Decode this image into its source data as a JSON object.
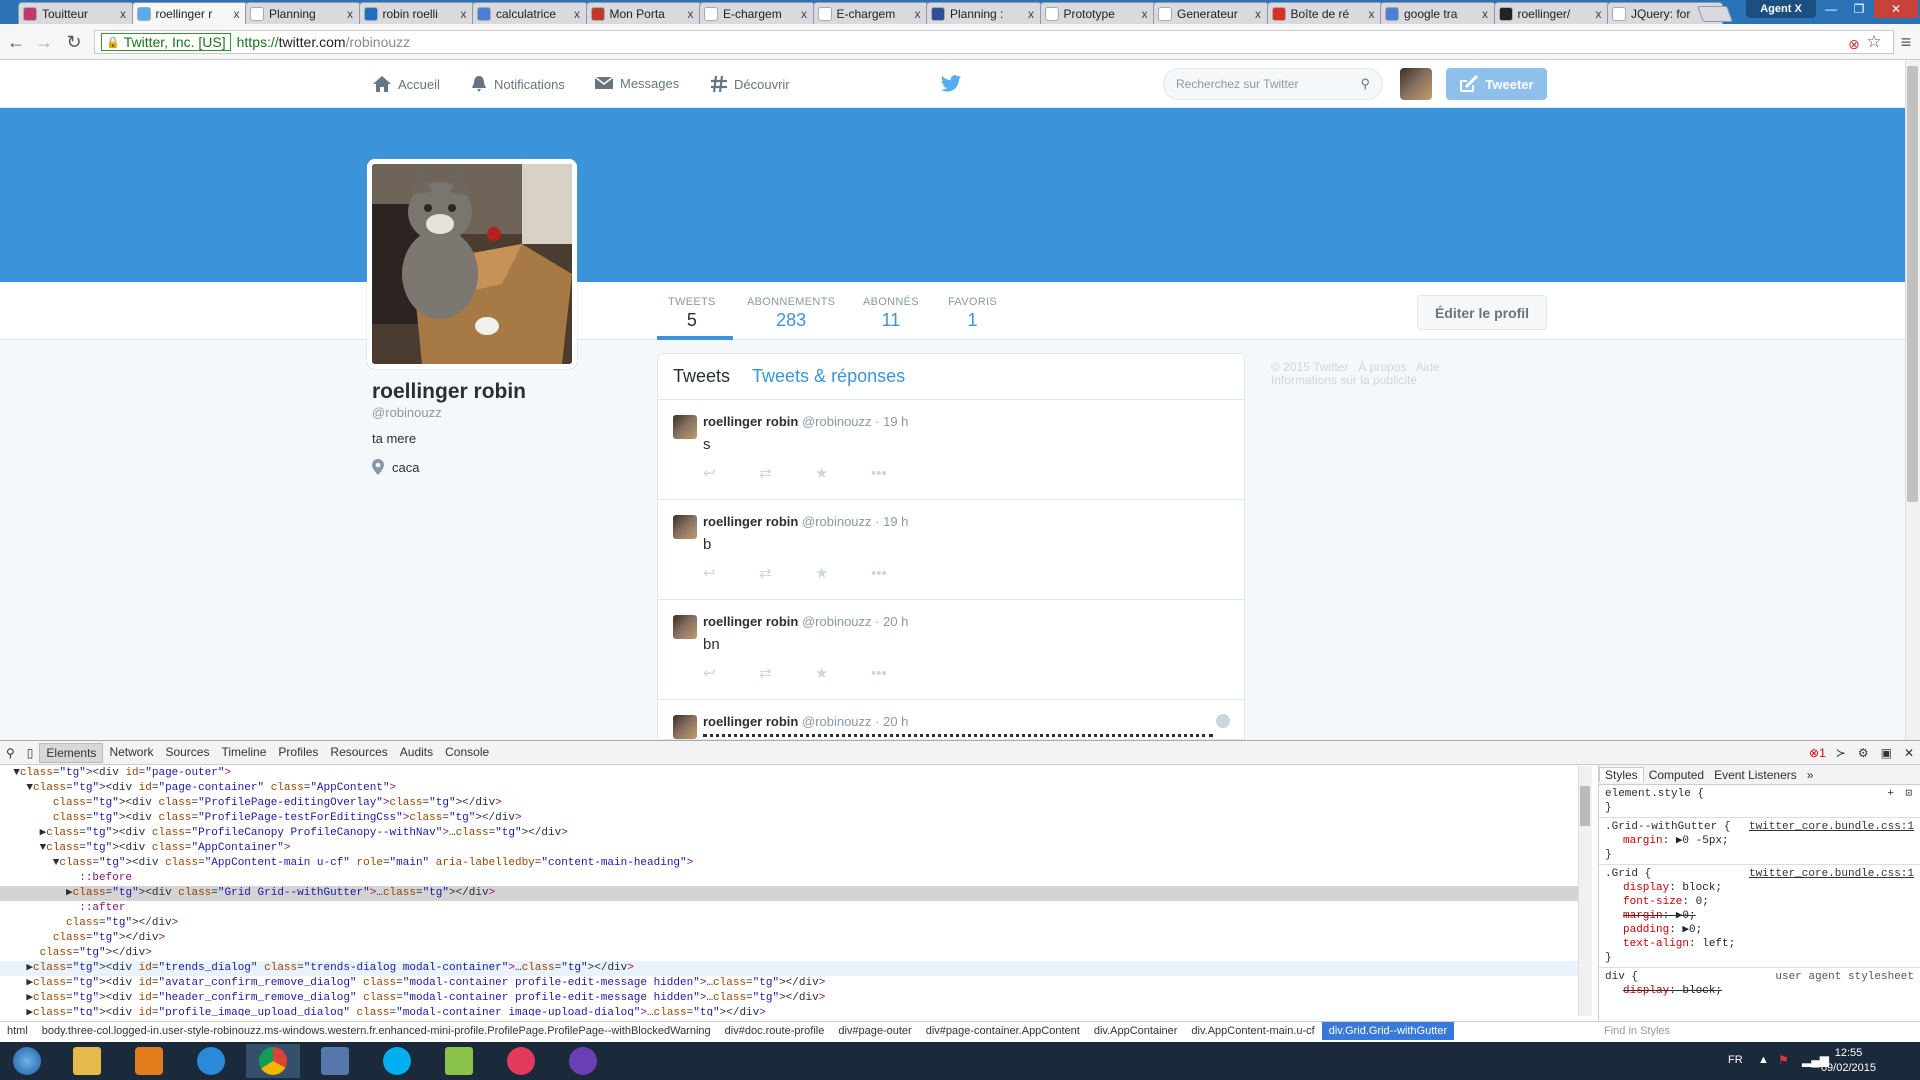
{
  "browser": {
    "tabs": [
      {
        "label": "Touitteur",
        "color": "#c0396b"
      },
      {
        "label": "roellinger r",
        "color": "#55acee",
        "active": true
      },
      {
        "label": "Planning",
        "color": "#ffffff"
      },
      {
        "label": "robin roelli",
        "color": "#1e6fc4"
      },
      {
        "label": "calculatrice",
        "color": "#4a7fd8"
      },
      {
        "label": "Mon Porta",
        "color": "#c0392b"
      },
      {
        "label": "E-chargem",
        "color": "#ffffff"
      },
      {
        "label": "E-chargem",
        "color": "#ffffff"
      },
      {
        "label": "Planning :",
        "color": "#2c4f99"
      },
      {
        "label": "Prototype",
        "color": "#ffffff"
      },
      {
        "label": "Generateur",
        "color": "#ffffff"
      },
      {
        "label": "Boîte de ré",
        "color": "#d93025"
      },
      {
        "label": "google tra",
        "color": "#4a7fd8"
      },
      {
        "label": "roellinger/",
        "color": "#222222"
      },
      {
        "label": "JQuery: for",
        "color": "#ffffff"
      }
    ],
    "tab_close": "x",
    "profile_name": "Agent X",
    "ev_label": "Twitter, Inc. [US]",
    "url_scheme": "https://",
    "url_host": "twitter.com",
    "url_path": "/robinouzz"
  },
  "twitter": {
    "nav": {
      "home": "Accueil",
      "notifications": "Notifications",
      "messages": "Messages",
      "discover": "Découvrir",
      "search_placeholder": "Recherchez sur Twitter",
      "tweet_button": "Tweeter"
    },
    "stats": {
      "tweets_label": "TWEETS",
      "tweets_value": "5",
      "following_label": "ABONNEMENTS",
      "following_value": "283",
      "followers_label": "ABONNÉS",
      "followers_value": "11",
      "favorites_label": "FAVORIS",
      "favorites_value": "1"
    },
    "edit_profile": "Éditer le profil",
    "profile": {
      "name": "roellinger robin",
      "handle": "@robinouzz",
      "bio": "ta mere",
      "location": "caca"
    },
    "timeline_tabs": {
      "tweets": "Tweets",
      "replies": "Tweets & réponses"
    },
    "tweets": [
      {
        "name": "roellinger robin",
        "handle": "@robinouzz",
        "time": "· 19 h",
        "text": "s"
      },
      {
        "name": "roellinger robin",
        "handle": "@robinouzz",
        "time": "· 19 h",
        "text": "b"
      },
      {
        "name": "roellinger robin",
        "handle": "@robinouzz",
        "time": "· 20 h",
        "text": "bn"
      },
      {
        "name": "roellinger robin",
        "handle": "@robinouzz",
        "time": "· 20 h",
        "text": ""
      }
    ],
    "footer": {
      "copyright": "© 2015 Twitter",
      "about": "À propos",
      "help": "Aide",
      "ads": "Informations sur la publicité"
    }
  },
  "devtools": {
    "tabs": [
      "Elements",
      "Network",
      "Sources",
      "Timeline",
      "Profiles",
      "Resources",
      "Audits",
      "Console"
    ],
    "error_count": "1",
    "dom_lines": [
      "  ▼<div id=\"page-outer\">",
      "    ▼<div id=\"page-container\" class=\"AppContent\">",
      "        <div class=\"ProfilePage-editingOverlay\"></div>",
      "        <div class=\"ProfilePage-testForEditingCss\"></div>",
      "      ▶<div class=\"ProfileCanopy ProfileCanopy--withNav\">…</div>",
      "      ▼<div class=\"AppContainer\">",
      "        ▼<div class=\"AppContent-main u-cf\" role=\"main\" aria-labelledby=\"content-main-heading\">",
      "            ::before",
      "          ▶<div class=\"Grid Grid--withGutter\">…</div>",
      "            ::after",
      "          </div>",
      "        </div>",
      "      </div>",
      "    ▶<div id=\"trends_dialog\" class=\"trends-dialog modal-container\">…</div>",
      "    ▶<div id=\"avatar_confirm_remove_dialog\" class=\"modal-container profile-edit-message hidden\">…</div>",
      "    ▶<div id=\"header_confirm_remove_dialog\" class=\"modal-container profile-edit-message hidden\">…</div>",
      "    ▶<div id=\"profile_image_upload_dialog\" class=\"modal-container image-upload-dialog\">…</div>",
      "    </div>"
    ],
    "breadcrumbs": [
      "html",
      "body.three-col.logged-in.user-style-robinouzz.ms-windows.western.fr.enhanced-mini-profile.ProfilePage.ProfilePage--withBlockedWarning",
      "div#doc.route-profile",
      "div#page-outer",
      "div#page-container.AppContent",
      "div.AppContainer",
      "div.AppContent-main.u-cf",
      "div.Grid.Grid--withGutter"
    ],
    "styles_tabs": [
      "Styles",
      "Computed",
      "Event Listeners",
      "»"
    ],
    "styles": {
      "element_style": "element.style {",
      "close": "}",
      "rule1_selector": ".Grid--withGutter {",
      "rule1_source": "twitter_core.bundle.css:1",
      "rule1_props": [
        {
          "name": "margin",
          "value": "▶0 -5px;"
        }
      ],
      "rule2_selector": ".Grid {",
      "rule2_source": "twitter_core.bundle.css:1",
      "rule2_props": [
        {
          "name": "display",
          "value": "block;"
        },
        {
          "name": "font-size",
          "value": "0;"
        },
        {
          "name": "margin",
          "value": "▶0;",
          "strike": true
        },
        {
          "name": "padding",
          "value": "▶0;"
        },
        {
          "name": "text-align",
          "value": "left;"
        }
      ],
      "rule3_selector": "div {",
      "rule3_source": "user agent stylesheet",
      "rule3_props": [
        {
          "name": "display",
          "value": "block;",
          "strike": true
        }
      ]
    },
    "find_placeholder": "Find in Styles"
  },
  "taskbar": {
    "lang": "FR",
    "time": "12:55",
    "date": "09/02/2015"
  }
}
